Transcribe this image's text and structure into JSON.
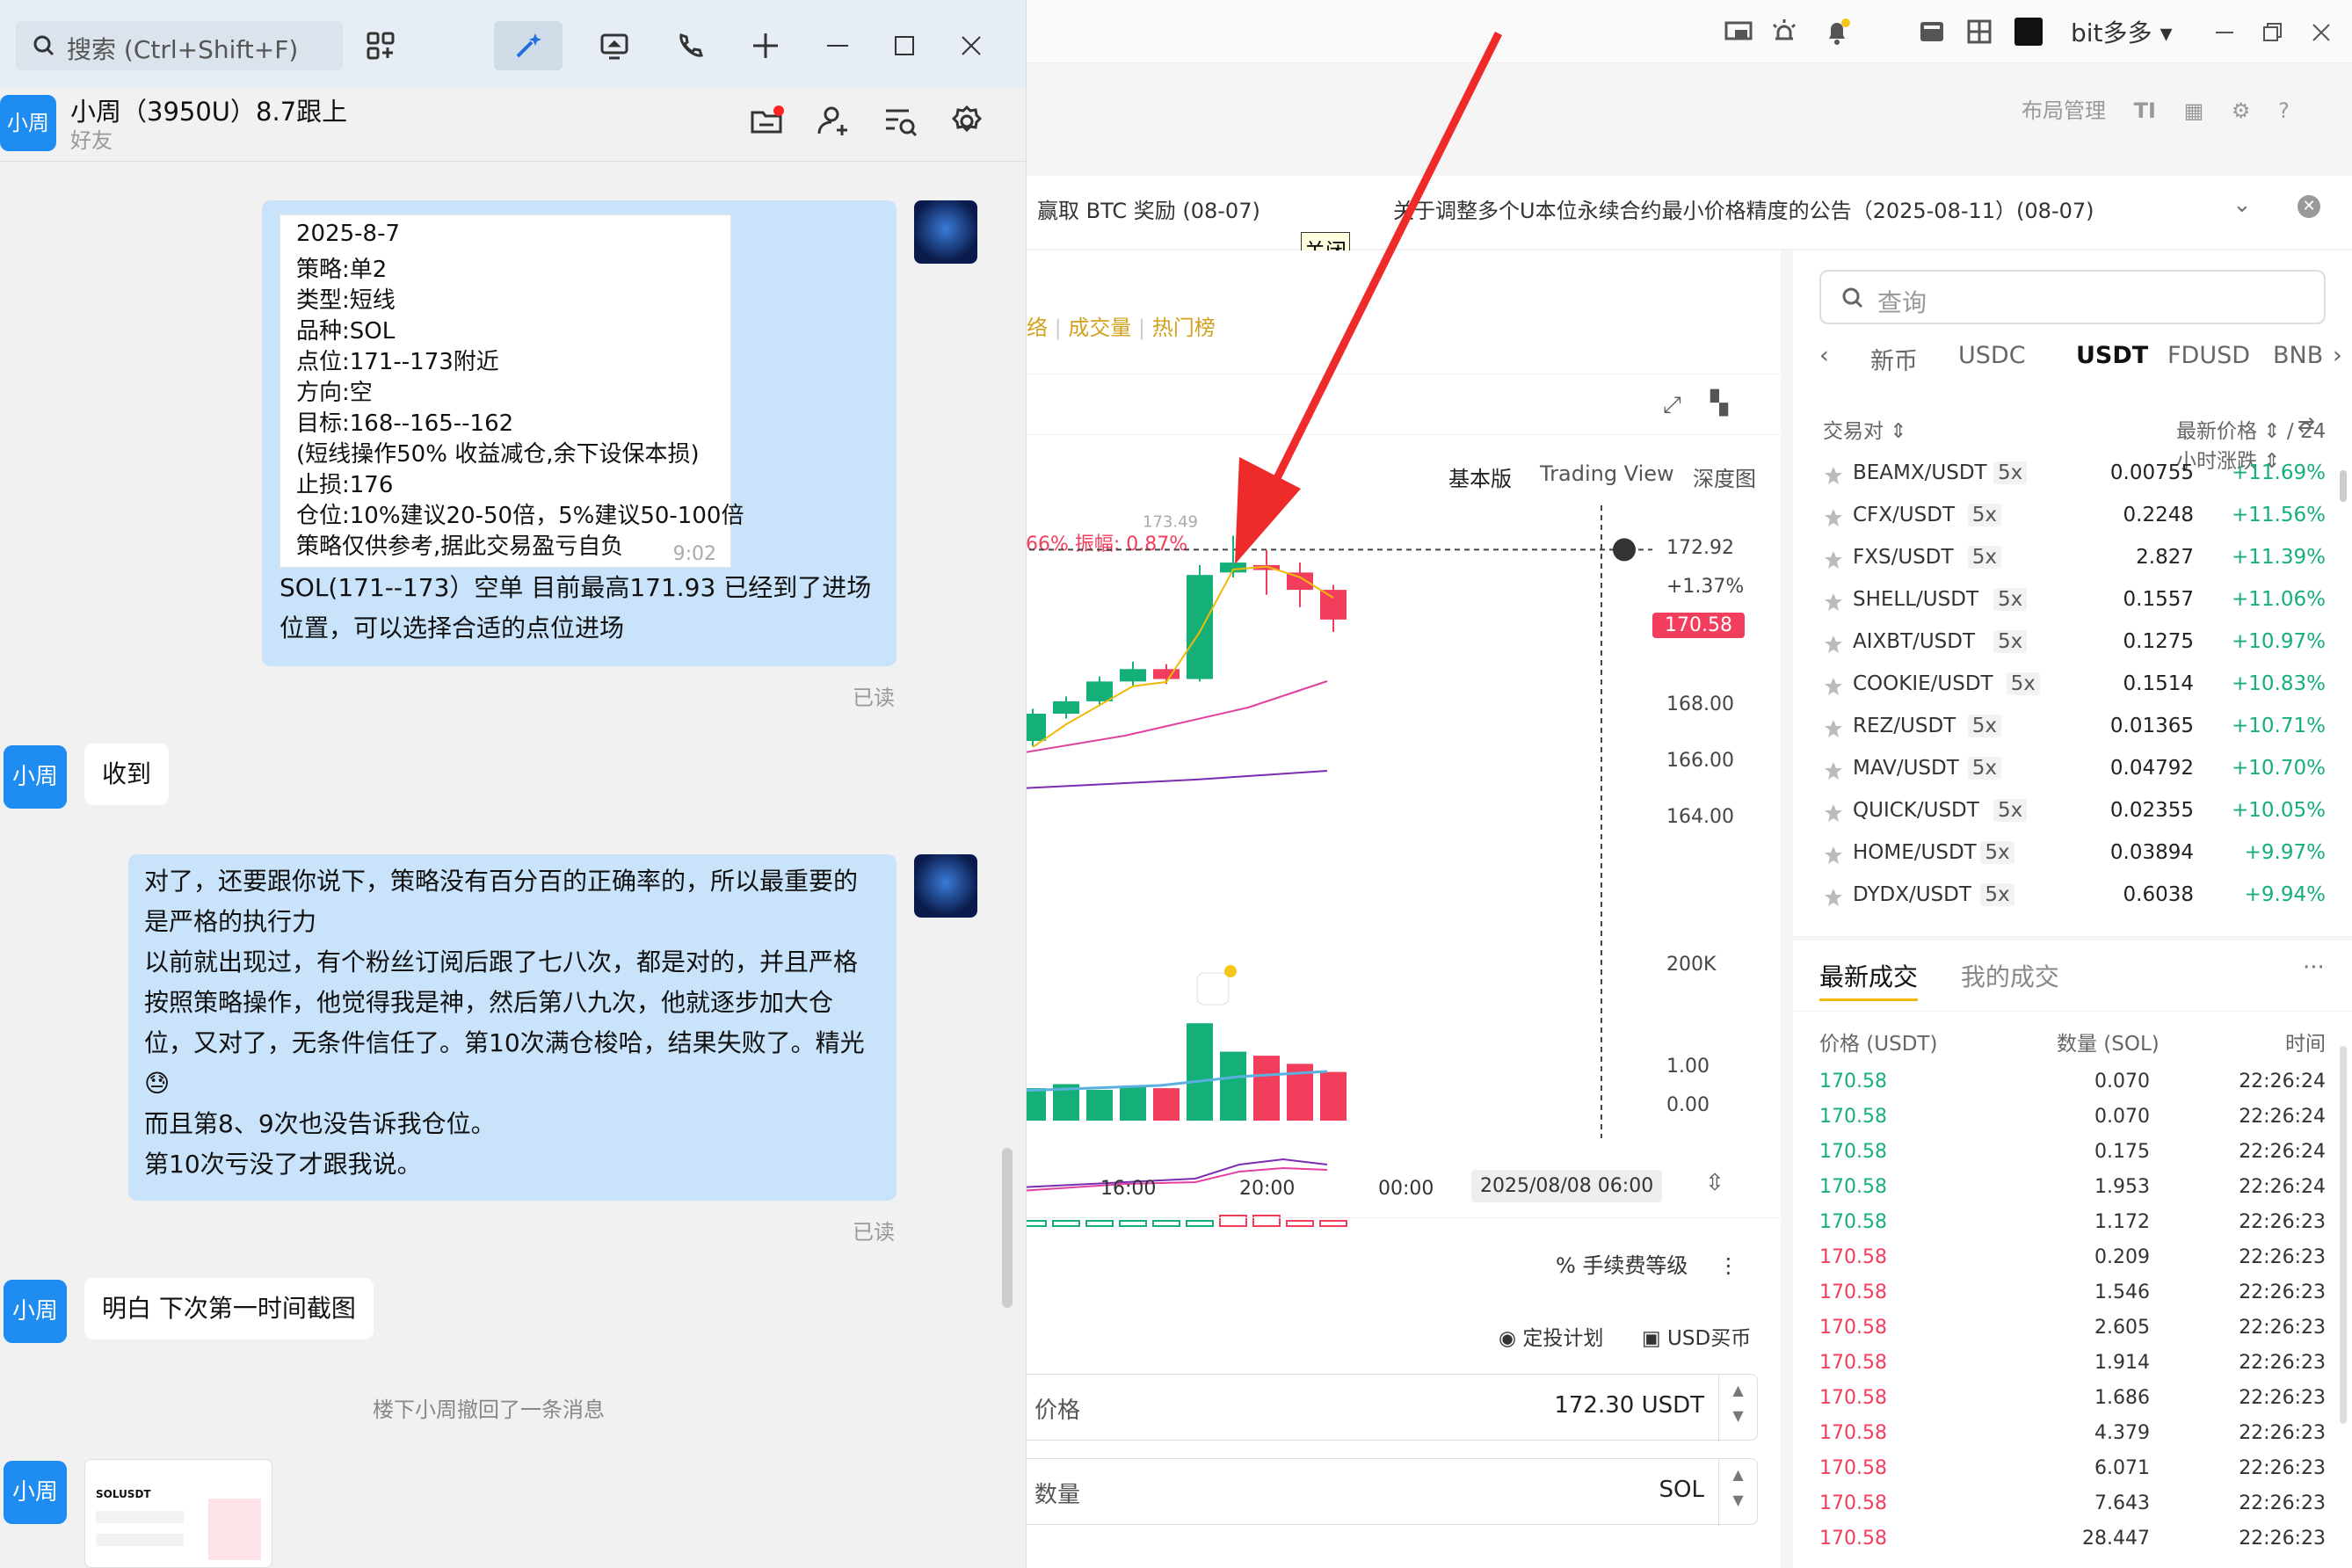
{
  "chat": {
    "search_placeholder": "搜索 (Ctrl+Shift+F)",
    "contact_name": "小周（3950U）8.7跟上",
    "contact_status": "好友",
    "avatar_text": "小周",
    "strategy_lines": [
      "2025-8-7",
      "策略:单2",
      "类型:短线",
      "品种:SOL",
      "点位:171--173附近",
      "方向:空",
      "目标:168--165--162",
      "(短线操作50% 收益减仓,余下设保本损)",
      "止损:176",
      "仓位:10%建议20-50倍，5%建议50-100倍",
      "策略仅供参考,据此交易盈亏自负"
    ],
    "strategy_time": "9:02",
    "msg1_line1": "SOL(171--173）空单   目前最高171.93   已经到了进场",
    "msg1_line2": "位置，可以选择合适的点位进场",
    "read_label": "已读",
    "reply1": "收到",
    "msg2_lines": [
      "对了，还要跟你说下，策略没有百分百的正确率的，所以最重要的",
      "是严格的执行力",
      "以前就出现过，有个粉丝订阅后跟了七八次，都是对的，并且严格",
      "按照策略操作，他觉得我是神，然后第八九次，他就逐步加大仓",
      "位，又对了，无条件信任了。第10次满仓梭哈，结果失败了。精光",
      "😓",
      "而且第8、9次也没告诉我仓位。",
      "第10次亏没了才跟我说。"
    ],
    "reply2": "明白 下次第一时间截图",
    "system_msg": "楼下小周撤回了一条消息",
    "thumb_label": "SOLUSDT"
  },
  "exchange": {
    "user_name": "bit多多",
    "layout_label": "布局管理",
    "announce1": "赢取 BTC 奖励 (08-07)",
    "announce2": "关于调整多个U本位永续合约最小价格精度的公告（2025-08-11）(08-07)",
    "close_label": "关闭",
    "tab_links": [
      "络",
      "成交量",
      "热门榜"
    ],
    "chart_views": [
      "基本版",
      "Trading View",
      "深度图"
    ],
    "chart_stats": ".66%  振幅: ",
    "chart_amp": "0.87%",
    "high_label": "173.49",
    "price_axis": [
      "172.92",
      "+1.37%",
      "170.58",
      "168.00",
      "166.00",
      "164.00"
    ],
    "vol_axis": "200K",
    "ind_axis": [
      "1.00",
      "0.00"
    ],
    "x_labels": [
      "16:00",
      "20:00",
      "00:00",
      "2025/08/08 06:00"
    ],
    "fee_label": "手续费等级",
    "plan_label": "定投计划",
    "usd_buy": "USD买币",
    "price_field": {
      "label": "价格",
      "value": "172.30",
      "unit": "USDT"
    },
    "qty_field": {
      "label": "数量",
      "unit": "SOL"
    },
    "search_placeholder": "查询",
    "currency_tabs": [
      "新币",
      "USDC",
      "USDT",
      "FDUSD",
      "BNB"
    ],
    "list_headers": {
      "pair": "交易对 ⇕",
      "price": "最新价格 ⇕ / 24 小时涨跌 ⇕"
    },
    "pairs": [
      {
        "name": "BEAMX/USDT",
        "lev": "5x",
        "price": "0.00755",
        "change": "+11.69%"
      },
      {
        "name": "CFX/USDT",
        "lev": "5x",
        "price": "0.2248",
        "change": "+11.56%"
      },
      {
        "name": "FXS/USDT",
        "lev": "5x",
        "price": "2.827",
        "change": "+11.39%"
      },
      {
        "name": "SHELL/USDT",
        "lev": "5x",
        "price": "0.1557",
        "change": "+11.06%"
      },
      {
        "name": "AIXBT/USDT",
        "lev": "5x",
        "price": "0.1275",
        "change": "+10.97%"
      },
      {
        "name": "COOKIE/USDT",
        "lev": "5x",
        "price": "0.1514",
        "change": "+10.83%"
      },
      {
        "name": "REZ/USDT",
        "lev": "5x",
        "price": "0.01365",
        "change": "+10.71%"
      },
      {
        "name": "MAV/USDT",
        "lev": "5x",
        "price": "0.04792",
        "change": "+10.70%"
      },
      {
        "name": "QUICK/USDT",
        "lev": "5x",
        "price": "0.02355",
        "change": "+10.05%"
      },
      {
        "name": "HOME/USDT",
        "lev": "5x",
        "price": "0.03894",
        "change": "+9.97%"
      },
      {
        "name": "DYDX/USDT",
        "lev": "5x",
        "price": "0.6038",
        "change": "+9.94%"
      }
    ],
    "trades_tabs": [
      "最新成交",
      "我的成交"
    ],
    "trades_headers": [
      "价格 (USDT)",
      "数量 (SOL)",
      "时间"
    ],
    "trades": [
      {
        "price": "170.58",
        "qty": "0.070",
        "time": "22:26:24",
        "side": "buy"
      },
      {
        "price": "170.58",
        "qty": "0.070",
        "time": "22:26:24",
        "side": "buy"
      },
      {
        "price": "170.58",
        "qty": "0.175",
        "time": "22:26:24",
        "side": "buy"
      },
      {
        "price": "170.58",
        "qty": "1.953",
        "time": "22:26:24",
        "side": "buy"
      },
      {
        "price": "170.58",
        "qty": "1.172",
        "time": "22:26:23",
        "side": "buy"
      },
      {
        "price": "170.58",
        "qty": "0.209",
        "time": "22:26:23",
        "side": "sell"
      },
      {
        "price": "170.58",
        "qty": "1.546",
        "time": "22:26:23",
        "side": "sell"
      },
      {
        "price": "170.58",
        "qty": "2.605",
        "time": "22:26:23",
        "side": "sell"
      },
      {
        "price": "170.58",
        "qty": "1.914",
        "time": "22:26:23",
        "side": "sell"
      },
      {
        "price": "170.58",
        "qty": "1.686",
        "time": "22:26:23",
        "side": "sell"
      },
      {
        "price": "170.58",
        "qty": "4.379",
        "time": "22:26:23",
        "side": "sell"
      },
      {
        "price": "170.58",
        "qty": "6.071",
        "time": "22:26:23",
        "side": "sell"
      },
      {
        "price": "170.58",
        "qty": "7.643",
        "time": "22:26:23",
        "side": "sell"
      },
      {
        "price": "170.58",
        "qty": "28.447",
        "time": "22:26:23",
        "side": "sell"
      }
    ],
    "candles": [
      {
        "o": 165.2,
        "c": 166.3,
        "h": 166.5,
        "l": 165.0
      },
      {
        "o": 166.3,
        "c": 166.8,
        "h": 167.0,
        "l": 166.1
      },
      {
        "o": 166.8,
        "c": 167.6,
        "h": 167.8,
        "l": 166.6
      },
      {
        "o": 167.6,
        "c": 168.1,
        "h": 168.4,
        "l": 167.4
      },
      {
        "o": 168.1,
        "c": 167.7,
        "h": 168.3,
        "l": 167.5
      },
      {
        "o": 167.7,
        "c": 171.9,
        "h": 172.3,
        "l": 167.6
      },
      {
        "o": 172.0,
        "c": 172.4,
        "h": 173.49,
        "l": 171.8
      },
      {
        "o": 172.3,
        "c": 172.1,
        "h": 172.9,
        "l": 171.1
      },
      {
        "o": 172.0,
        "c": 171.3,
        "h": 172.4,
        "l": 170.6
      },
      {
        "o": 171.3,
        "c": 170.1,
        "h": 171.5,
        "l": 169.6
      }
    ],
    "volumes": [
      40,
      45,
      38,
      42,
      40,
      120,
      85,
      80,
      70,
      60
    ],
    "colors": {
      "up": "#15b077",
      "down": "#f23e5c",
      "accent": "#1e8cf0",
      "gold": "#d4a11e"
    }
  }
}
